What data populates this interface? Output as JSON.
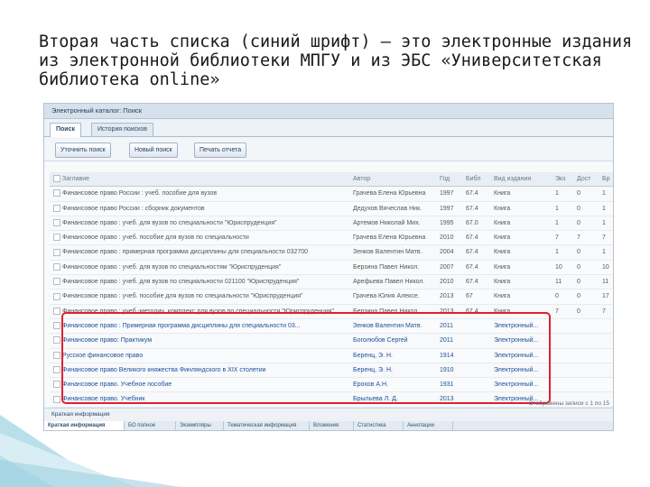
{
  "slide": {
    "title_lines": [
      "Вторая часть списка (синий шрифт) – это электронные издания",
      "из электронной библиотеки МПГУ и из ЭБС «Университетская",
      "библиотека online»"
    ]
  },
  "window": {
    "title": "Электронный каталог: Поиск"
  },
  "tabs": [
    {
      "label": "Поиск"
    },
    {
      "label": "История поисков"
    }
  ],
  "toolbar": {
    "refine_label": "Уточнить поиск",
    "new_label": "Новый поиск",
    "print_label": "Печать отчета"
  },
  "columns": {
    "title": "Заглавие",
    "author": "Автор",
    "year": "Год",
    "bbk": "Библ",
    "type": "Вид издания",
    "n1": "Экз",
    "n2": "Дост",
    "n3": "Бр"
  },
  "rows": [
    {
      "title": "Финансовое право России : учеб. пособие для вузов",
      "author": "Грачева Елена Юрьевна",
      "year": "1997",
      "bbk": "67.4",
      "type": "Книга",
      "n1": "1",
      "n2": "0",
      "n3": "1",
      "blue": false
    },
    {
      "title": "Финансовое право России : сборник документов",
      "author": "Дедухов Вячеслав Ник.",
      "year": "1997",
      "bbk": "67.4",
      "type": "Книга",
      "n1": "1",
      "n2": "0",
      "n3": "1",
      "blue": false
    },
    {
      "title": "Финансовое право : учеб. для вузов по специальности \"Юриспруденция\"",
      "author": "Артемов Николай Мих.",
      "year": "1995",
      "bbk": "67.0",
      "type": "Книга",
      "n1": "1",
      "n2": "0",
      "n3": "1",
      "blue": false
    },
    {
      "title": "Финансовое право : учеб. пособие для вузов по специальности",
      "author": "Грачева Елена Юрьевна",
      "year": "2010",
      "bbk": "67.4",
      "type": "Книга",
      "n1": "7",
      "n2": "7",
      "n3": "7",
      "blue": false
    },
    {
      "title": "Финансовое право : примерная программа дисциплины для специальности 032700",
      "author": "Зенков Валентин Матв.",
      "year": "2004",
      "bbk": "67.4",
      "type": "Книга",
      "n1": "1",
      "n2": "0",
      "n3": "1",
      "blue": false
    },
    {
      "title": "Финансовое право : учеб. для вузов по специальностям \"Юриспруденция\"",
      "author": "Берзина Павел Никол.",
      "year": "2007",
      "bbk": "67.4",
      "type": "Книга",
      "n1": "10",
      "n2": "0",
      "n3": "10",
      "blue": false
    },
    {
      "title": "Финансовое право : учеб. для вузов по специальности 021100 \"Юриспруденция\"",
      "author": "Арефьева Павел Никол.",
      "year": "2010",
      "bbk": "67.4",
      "type": "Книга",
      "n1": "11",
      "n2": "0",
      "n3": "11",
      "blue": false
    },
    {
      "title": "Финансовое право : учеб. пособие для вузов по специальности \"Юриспруденция\"",
      "author": "Грачева Юлия Алексе.",
      "year": "2013",
      "bbk": "67",
      "type": "Книга",
      "n1": "0",
      "n2": "0",
      "n3": "17",
      "blue": false
    },
    {
      "title": "Финансовое право : учеб.-методич. комплекс для вузов по специальности \"Юриспруденция\"",
      "author": "Берзина Павел Никол.",
      "year": "2013",
      "bbk": "67.4",
      "type": "Книга",
      "n1": "7",
      "n2": "0",
      "n3": "7",
      "blue": false
    },
    {
      "title": "Финансовое право : Примерная программа дисциплины для специальности 03...",
      "author": "Зенков Валентин Матв.",
      "year": "2011",
      "bbk": "",
      "type": "Электронный...",
      "n1": "",
      "n2": "",
      "n3": "",
      "blue": true
    },
    {
      "title": "Финансовое право: Практикум",
      "author": "Боголюбов Сергей",
      "year": "2011",
      "bbk": "",
      "type": "Электронный...",
      "n1": "",
      "n2": "",
      "n3": "",
      "blue": true
    },
    {
      "title": "Русское финансовое право",
      "author": "Беренц, Э. Н.",
      "year": "1914",
      "bbk": "",
      "type": "Электронный...",
      "n1": "",
      "n2": "",
      "n3": "",
      "blue": true
    },
    {
      "title": "Финансовое право Великого княжества Финляндского в XIX столетии",
      "author": "Беренц, Э. Н.",
      "year": "1910",
      "bbk": "",
      "type": "Электронный...",
      "n1": "",
      "n2": "",
      "n3": "",
      "blue": true
    },
    {
      "title": "Финансовое право. Учебное пособие",
      "author": "Ерохов А.Н.",
      "year": "1931",
      "bbk": "",
      "type": "Электронный...",
      "n1": "",
      "n2": "",
      "n3": "",
      "blue": true
    },
    {
      "title": "Финансовое право. Учебник",
      "author": "Брыльева Л. Д.",
      "year": "2013",
      "bbk": "",
      "type": "Электронный...",
      "n1": "",
      "n2": "",
      "n3": "",
      "blue": true
    }
  ],
  "status": {
    "left": "Краткая информация",
    "right": "Отображены записи с 1 по 15"
  },
  "bottom_tabs": [
    {
      "label": "Краткая информация"
    },
    {
      "label": "БО полное"
    },
    {
      "label": "Экземпляры"
    },
    {
      "label": "Тематическая информация"
    },
    {
      "label": "Вложения"
    },
    {
      "label": "Статистика"
    },
    {
      "label": "Аннотации"
    }
  ]
}
